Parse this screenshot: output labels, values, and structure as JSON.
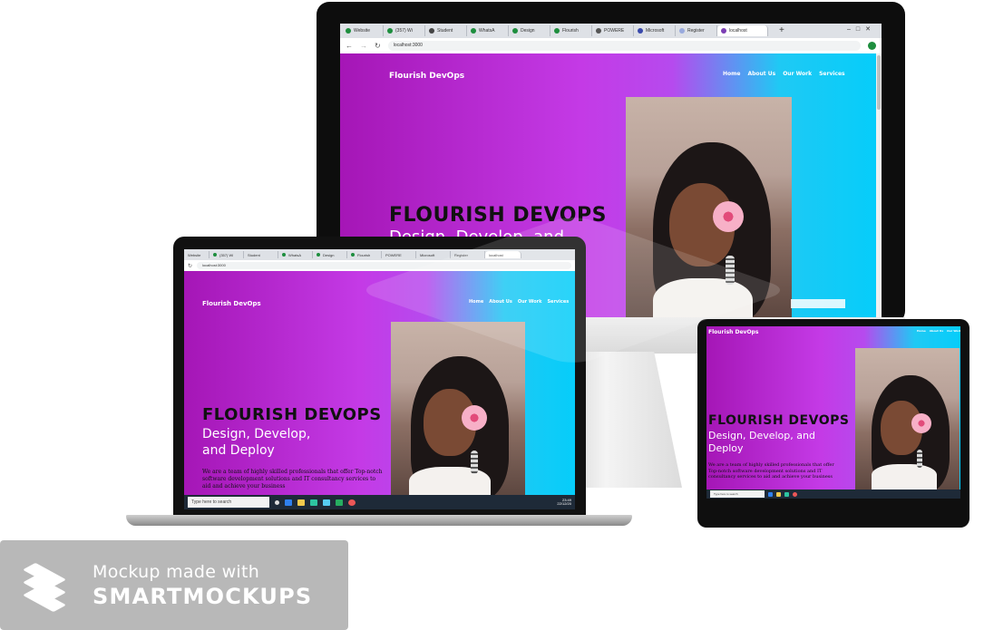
{
  "site": {
    "brand": "Flourish DevOps",
    "nav": [
      "Home",
      "About Us",
      "Our Work",
      "Services"
    ],
    "hero_title": "FLOURISH DEVOPS",
    "hero_subtitle": "Design, Develop, and Deploy",
    "hero_subtitle_partial": "Design, Develop, and",
    "hero_body": "We are a team of highly skilled professionals that offer Top-notch software development solutions and IT consultancy services to aid and achieve your business"
  },
  "browser": {
    "url": "localhost:3000",
    "tabs": [
      "Website",
      "(357) Wi",
      "Student",
      "WhatsA",
      "Design",
      "Flourish",
      "POWERE",
      "Microsoft",
      "Register",
      "localhost"
    ]
  },
  "taskbar": {
    "search_placeholder": "Type here to search",
    "time": "23:49",
    "date": "22/12/20",
    "weather": "24°C"
  },
  "watermark": {
    "line1": "Mockup made with",
    "line2": "SMARTMOCKUPS"
  },
  "colors": {
    "gradient_left": "#a516b6",
    "gradient_right": "#06cdfa",
    "badge_bg": "#b8b8b8"
  }
}
